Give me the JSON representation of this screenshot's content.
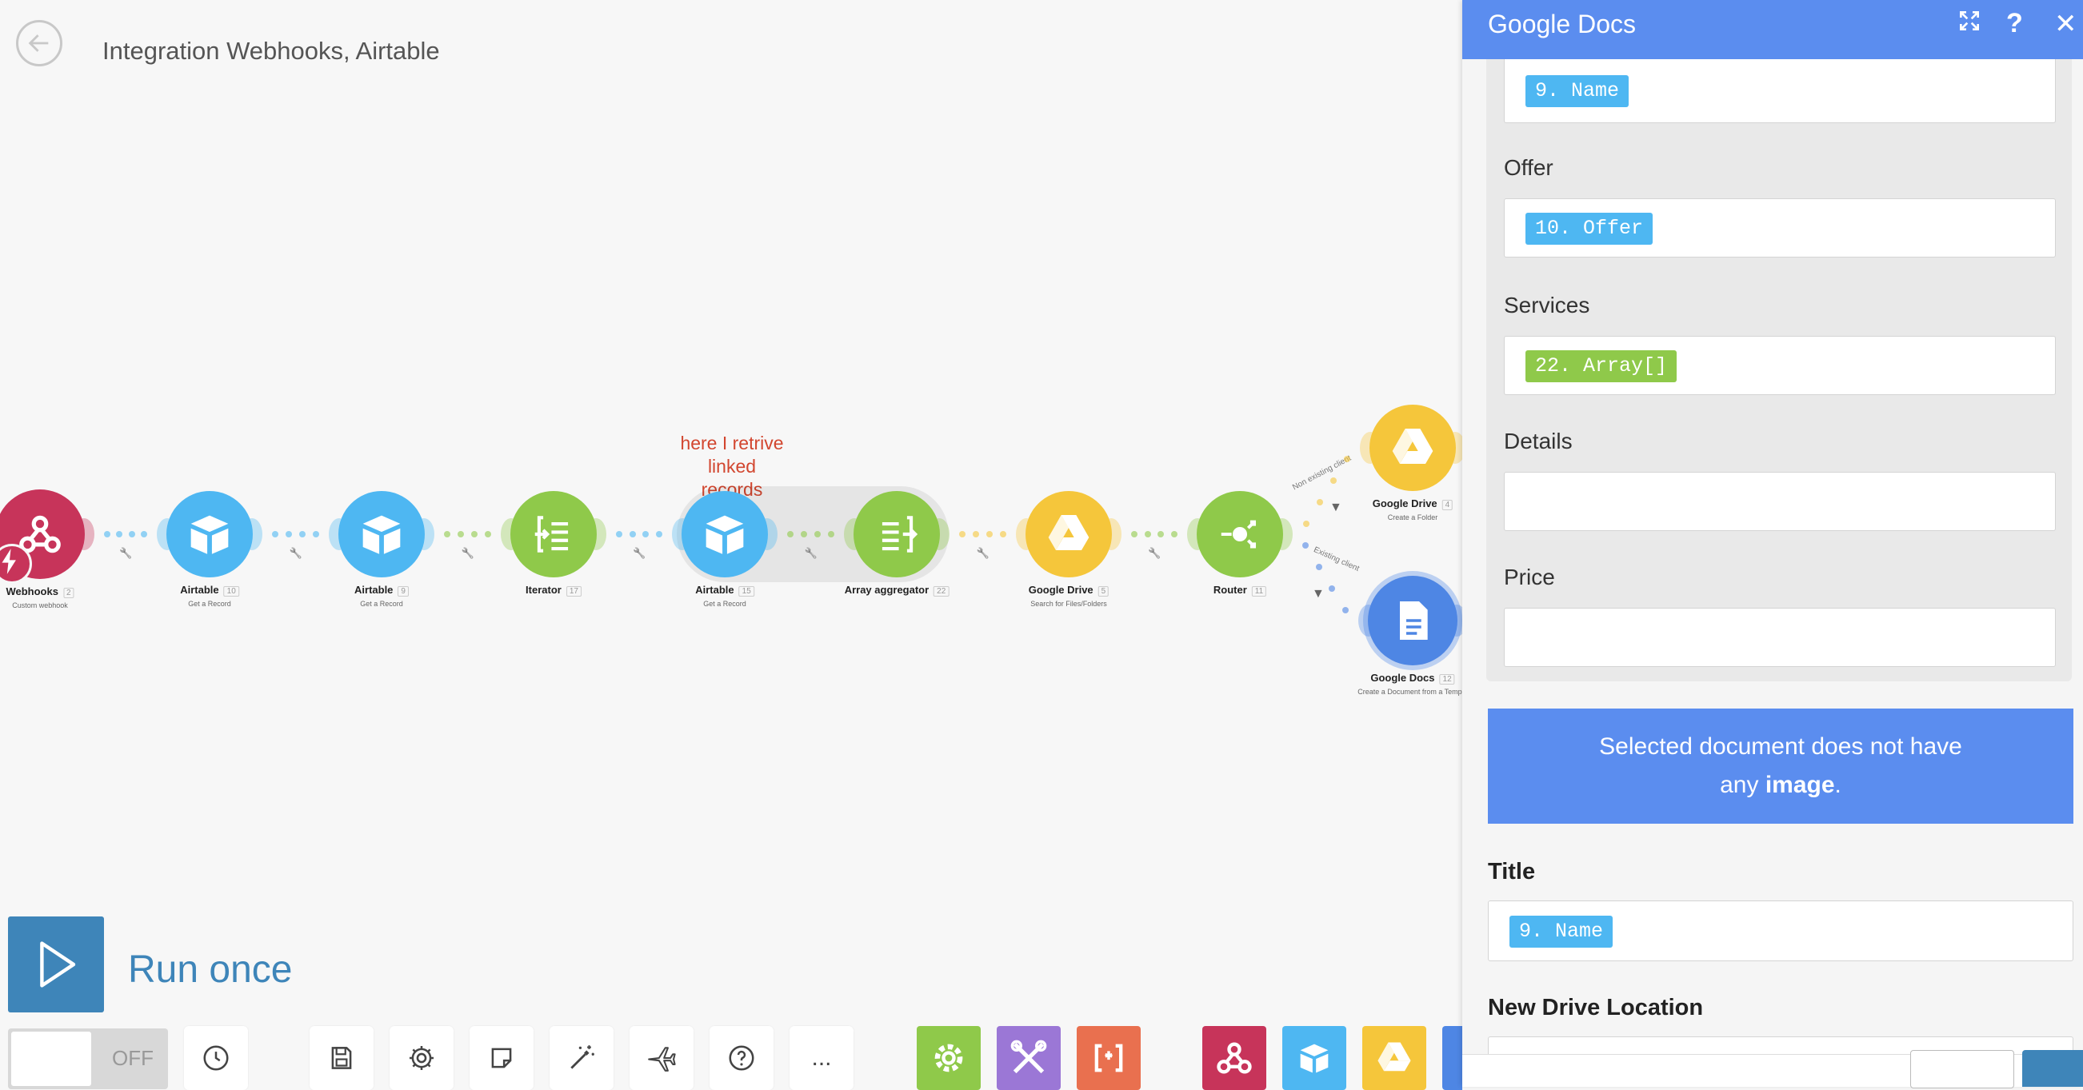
{
  "header": {
    "title": "Integration Webhooks, Airtable"
  },
  "canvas": {
    "annotation_line1": "here I retrive",
    "annotation_line2": "linked records",
    "route_label_top": "Non existing client",
    "route_label_bottom": "Existing client",
    "nodes": [
      {
        "name": "Webhooks",
        "id": "2",
        "action": "Custom webhook",
        "color": "#c7345a",
        "icon": "webhook-icon"
      },
      {
        "name": "Airtable",
        "id": "10",
        "action": "Get a Record",
        "color": "#4eb7f2",
        "icon": "airtable-icon"
      },
      {
        "name": "Airtable",
        "id": "9",
        "action": "Get a Record",
        "color": "#4eb7f2",
        "icon": "airtable-icon"
      },
      {
        "name": "Iterator",
        "id": "17",
        "action": "",
        "color": "#8fc94a",
        "icon": "iterator-icon"
      },
      {
        "name": "Airtable",
        "id": "15",
        "action": "Get a Record",
        "color": "#4eb7f2",
        "icon": "airtable-icon"
      },
      {
        "name": "Array aggregator",
        "id": "22",
        "action": "",
        "color": "#8fc94a",
        "icon": "aggregator-icon"
      },
      {
        "name": "Google Drive",
        "id": "5",
        "action": "Search for Files/Folders",
        "color": "#f5c63b",
        "icon": "google-drive-icon"
      },
      {
        "name": "Router",
        "id": "11",
        "action": "",
        "color": "#8fc94a",
        "icon": "router-icon"
      },
      {
        "name": "Google Drive",
        "id": "4",
        "action": "Create a Folder",
        "color": "#f5c63b",
        "icon": "google-drive-icon"
      },
      {
        "name": "Google Docs",
        "id": "12",
        "action": "Create a Document from a Templa",
        "color": "#4e86e4",
        "icon": "google-docs-icon"
      }
    ]
  },
  "run": {
    "label": "Run once"
  },
  "toolbar": {
    "toggle_label": "OFF",
    "tools": [
      "clock-icon",
      "save-icon",
      "gear-icon",
      "note-icon",
      "magic-wand-icon",
      "airplane-icon",
      "help-icon",
      "more-icon"
    ],
    "more_label": "...",
    "apps": [
      "tools-gear-icon",
      "tools-wrench-icon",
      "text-parser-icon",
      "webhooks-app-icon",
      "airtable-app-icon",
      "google-drive-app-icon"
    ]
  },
  "panel": {
    "title": "Google Docs",
    "fields": [
      {
        "label": "",
        "token": "9. Name",
        "token_color": "#4eb7f2"
      },
      {
        "label": "Offer",
        "token": "10. Offer",
        "token_color": "#4eb7f2"
      },
      {
        "label": "Services",
        "token": "22. Array[]",
        "token_color": "#8fc94a"
      },
      {
        "label": "Details",
        "token": ""
      },
      {
        "label": "Price",
        "token": ""
      }
    ],
    "notice_line1": "Selected document does not have",
    "notice_line2_pre": "any ",
    "notice_line2_bold": "image",
    "notice_line2_post": ".",
    "title_label": "Title",
    "title_token": "9. Name",
    "drive_location_label": "New Drive Location"
  }
}
